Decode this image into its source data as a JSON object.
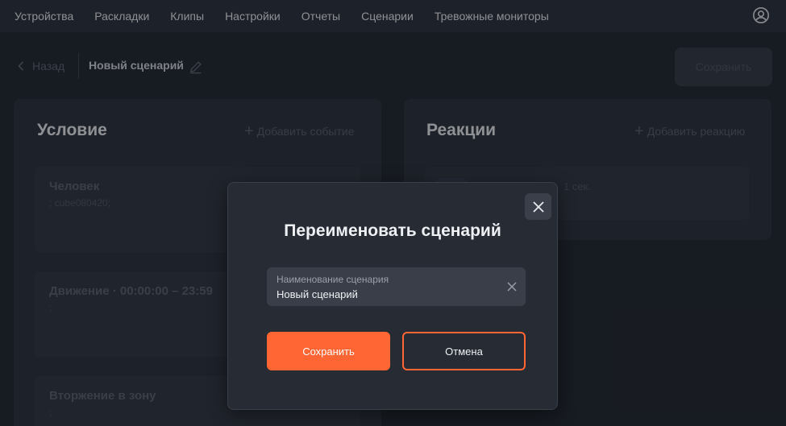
{
  "nav": {
    "items": [
      "Устройства",
      "Раскладки",
      "Клипы",
      "Настройки",
      "Отчеты",
      "Сценарии",
      "Тревожные мониторы"
    ],
    "user_icon": "user-circle-icon"
  },
  "header": {
    "back_label": "Назад",
    "scenario_title": "Новый сценарий",
    "save_label": "Сохранить"
  },
  "condition_panel": {
    "title": "Условие",
    "add_label": "Добавить событие",
    "cards": [
      {
        "title": "Человек",
        "sub": "; cube080420;"
      },
      {
        "title": "Движение · 00:00:00 – 23:59",
        "sub": ";"
      },
      {
        "title": "Вторжение в зону",
        "sub": ";"
      }
    ]
  },
  "reaction_panel": {
    "title": "Реакции",
    "add_label": "Добавить реакцию",
    "card_text": "1 сек."
  },
  "modal": {
    "title": "Переименовать сценарий",
    "field_label": "Наименование сценария",
    "field_value": "Новый сценарий",
    "save_label": "Сохранить",
    "cancel_label": "Отмена"
  },
  "colors": {
    "accent": "#ff6633",
    "background": "#1b1f27",
    "panel": "#262b34"
  }
}
